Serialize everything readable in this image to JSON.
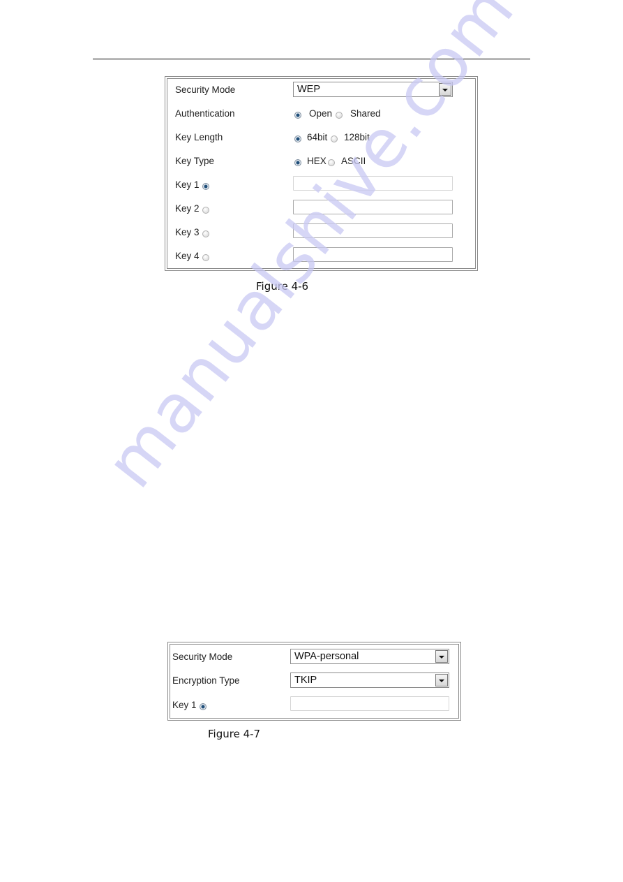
{
  "watermark": "manualshive.com",
  "figure_4_6": {
    "caption": "Figure 4-6",
    "security_mode": {
      "label": "Security Mode",
      "value": "WEP"
    },
    "authentication": {
      "label": "Authentication",
      "options": [
        "Open",
        "Shared"
      ],
      "selected": "Open"
    },
    "key_length": {
      "label": "Key Length",
      "options": [
        "64bit",
        "128bit"
      ],
      "selected": "64bit"
    },
    "key_type": {
      "label": "Key Type",
      "options": [
        "HEX",
        "ASCII"
      ],
      "selected": "HEX"
    },
    "keys": [
      {
        "label": "Key 1",
        "selected": true,
        "value": ""
      },
      {
        "label": "Key 2",
        "selected": false,
        "value": ""
      },
      {
        "label": "Key 3",
        "selected": false,
        "value": ""
      },
      {
        "label": "Key 4",
        "selected": false,
        "value": ""
      }
    ]
  },
  "figure_4_7": {
    "caption": "Figure 4-7",
    "security_mode": {
      "label": "Security Mode",
      "value": "WPA-personal"
    },
    "encryption_type": {
      "label": "Encryption Type",
      "value": "TKIP"
    },
    "keys": [
      {
        "label": "Key 1",
        "selected": true,
        "value": ""
      }
    ]
  }
}
